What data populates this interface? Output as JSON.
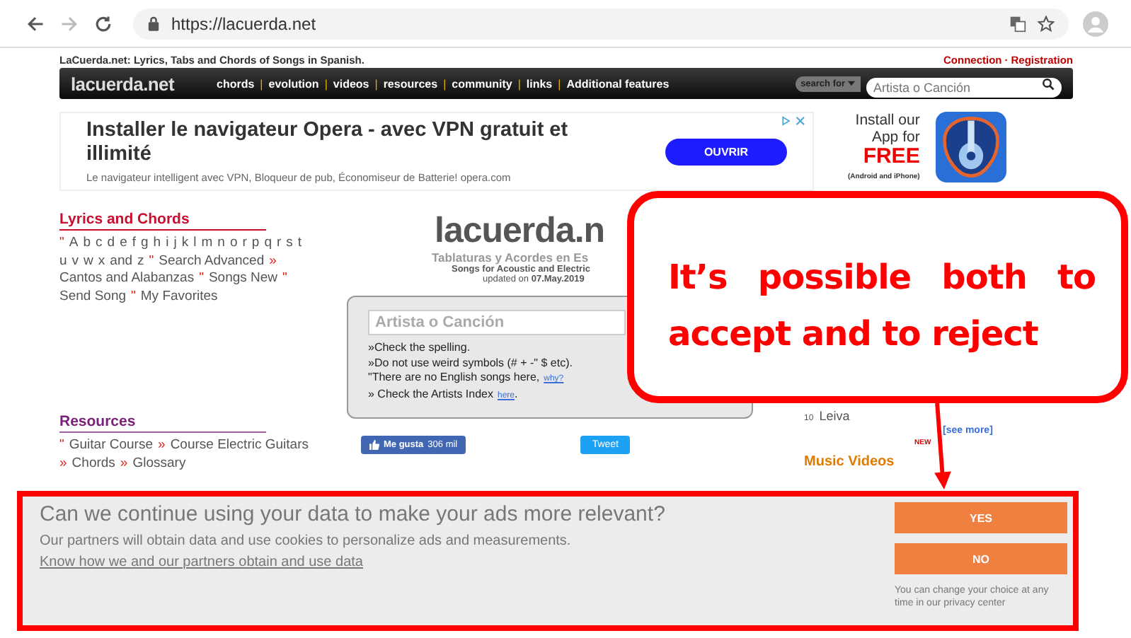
{
  "browser": {
    "url": "https://lacuerda.net"
  },
  "topbar": {
    "tagline": "LaCuerda.net: Lyrics, Tabs and Chords of Songs in Spanish.",
    "links": [
      "Connection",
      "Registration"
    ],
    "separator": "·"
  },
  "nav": {
    "logo": "lacuerda.net",
    "items": [
      "chords",
      "evolution",
      "videos",
      "resources",
      "community",
      "links",
      "Additional features"
    ],
    "separator": "|",
    "search_label": "search for",
    "search_placeholder": "Artista o Canción"
  },
  "ad": {
    "headline": "Installer le navigateur Opera - avec VPN gratuit et illimité",
    "body": "Le navigateur intelligent avec VPN, Bloqueur de pub, Économiseur de Batterie! opera.com",
    "button": "OUVRIR"
  },
  "app_promo": {
    "line1": "Install our",
    "line2": "App for",
    "highlight": "FREE",
    "note": "(Android and iPhone)"
  },
  "lyrics": {
    "title": "Lyrics and Chords",
    "alpha_marker": "\"",
    "letters": [
      "A",
      "b",
      "c",
      "d",
      "e",
      "f",
      "g",
      "h",
      "i",
      "j",
      "k",
      "l",
      "m",
      "n",
      "o",
      "r",
      "p",
      "q",
      "r",
      "s",
      "t",
      "u",
      "v",
      "w",
      "x"
    ],
    "letters_joiner": "and",
    "last_letter": "z",
    "links": [
      {
        "marker": "\"",
        "text": "Search Advanced"
      },
      {
        "marker": "»",
        "text": "Cantos and Alabanzas"
      },
      {
        "marker": "\"",
        "text": "Songs New"
      },
      {
        "marker": "\"",
        "text": "Send Song"
      },
      {
        "marker": "\"",
        "text": "My Favorites"
      }
    ]
  },
  "resources": {
    "title": "Resources",
    "links": [
      {
        "marker": "\"",
        "text": "Guitar Course"
      },
      {
        "marker": "»",
        "text": "Course Electric Guitars"
      },
      {
        "marker": "»",
        "text": "Chords"
      },
      {
        "marker": "»",
        "text": "Glossary"
      }
    ]
  },
  "center": {
    "logo": "lacuerda.n",
    "subtitle": "Tablaturas y Acordes en Es",
    "tagline": "Songs for Acoustic and Electric",
    "updated_label": "updated on",
    "updated_date": "07.May.2019"
  },
  "search_box": {
    "placeholder": "Artista o Canción",
    "tips": [
      {
        "text": "»Check the spelling."
      },
      {
        "text": "»Do not use weird symbols (# + -\" $ etc)."
      },
      {
        "text": "\"There are no English songs here,",
        "link": "why?"
      },
      {
        "text": "» Check the Artists Index",
        "link": "here",
        "after": "."
      }
    ]
  },
  "social": {
    "like_label": "Me gusta",
    "like_count": "306 mil",
    "tweet": "Tweet"
  },
  "ranking": {
    "items": [
      {
        "rank": "10",
        "name": "Leiva"
      }
    ],
    "more": "[see more]"
  },
  "videos": {
    "title": "Music Videos",
    "badge": "NEW"
  },
  "callout": {
    "text": "It’s possible both to accept and to reject"
  },
  "consent": {
    "question": "Can we continue using your data to make your ads more relevant?",
    "text": "Our partners will obtain data and use cookies to personalize ads and measurements.",
    "link": "Know how we and our partners obtain and use data",
    "buttons": [
      "YES",
      "NO"
    ],
    "note": "You can change your choice at any time in our privacy center"
  }
}
